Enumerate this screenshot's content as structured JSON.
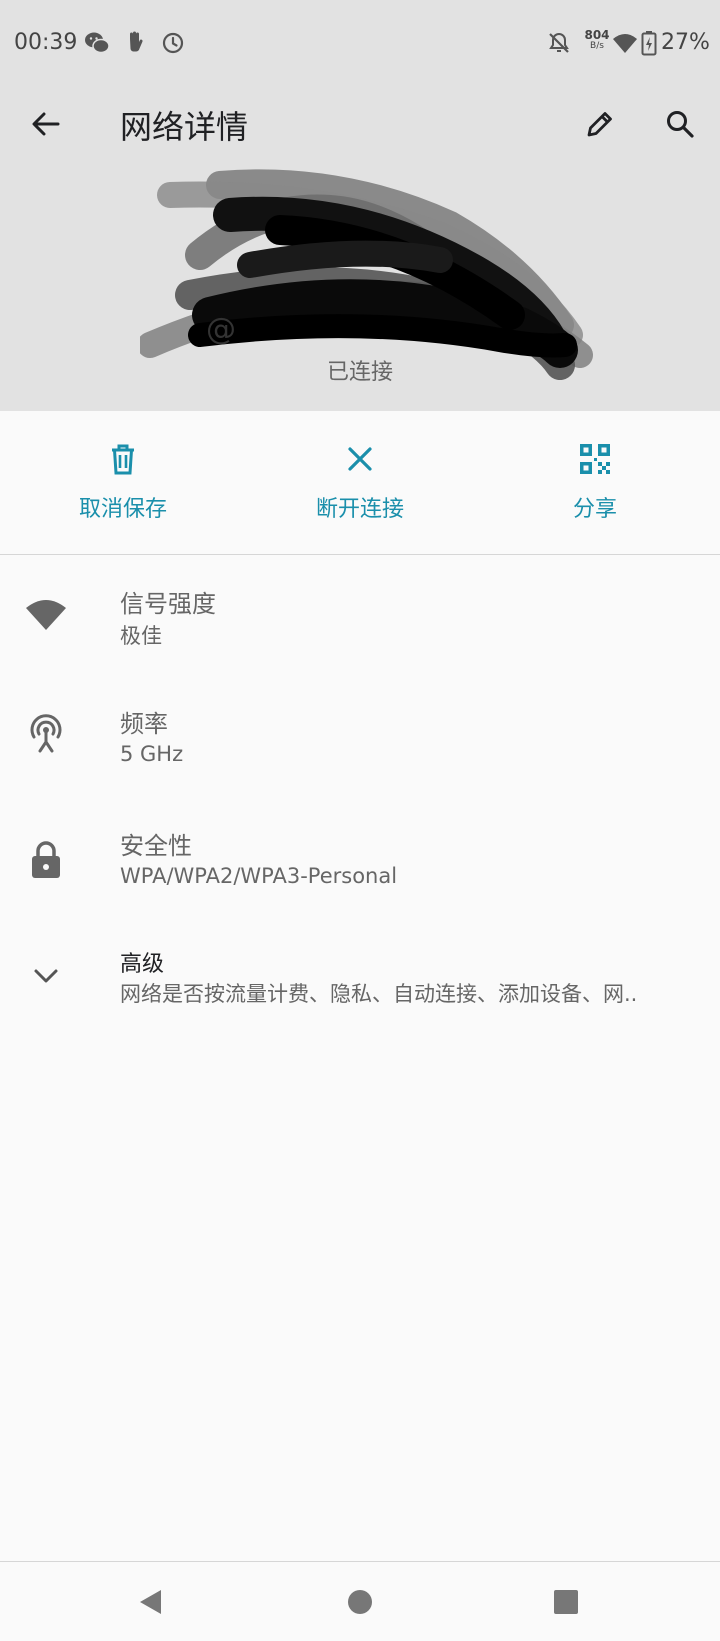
{
  "status_bar": {
    "time": "00:39",
    "left_icons": [
      "wechat-icon",
      "hand-icon",
      "clock-icon"
    ],
    "net_speed_value": "804",
    "net_speed_unit": "B/s",
    "battery_percent": "27%",
    "right_icons": [
      "notifications-off-icon",
      "wifi-icon",
      "battery-charging-icon"
    ]
  },
  "toolbar": {
    "title": "网络详情",
    "back_icon": "arrow-left-icon",
    "edit_icon": "pencil-icon",
    "search_icon": "search-icon"
  },
  "network": {
    "name_visible": "@",
    "status": "已连接"
  },
  "actions": [
    {
      "label": "取消保存",
      "icon": "trash-icon"
    },
    {
      "label": "断开连接",
      "icon": "close-icon"
    },
    {
      "label": "分享",
      "icon": "qr-code-icon"
    }
  ],
  "details": [
    {
      "title": "信号强度",
      "value": "极佳",
      "icon": "wifi-signal-icon"
    },
    {
      "title": "频率",
      "value": "5 GHz",
      "icon": "antenna-icon"
    },
    {
      "title": "安全性",
      "value": "WPA/WPA2/WPA3-Personal",
      "icon": "lock-icon"
    },
    {
      "title": "高级",
      "value": "网络是否按流量计费、隐私、自动连接、添加设备、网..",
      "icon": "chevron-down-icon"
    }
  ],
  "colors": {
    "accent": "#1a8fab",
    "header_bg": "#e2e2e2",
    "page_bg": "#fafafa"
  },
  "nav_bar": {
    "buttons": [
      "back-triangle-icon",
      "home-circle-icon",
      "recents-square-icon"
    ]
  }
}
